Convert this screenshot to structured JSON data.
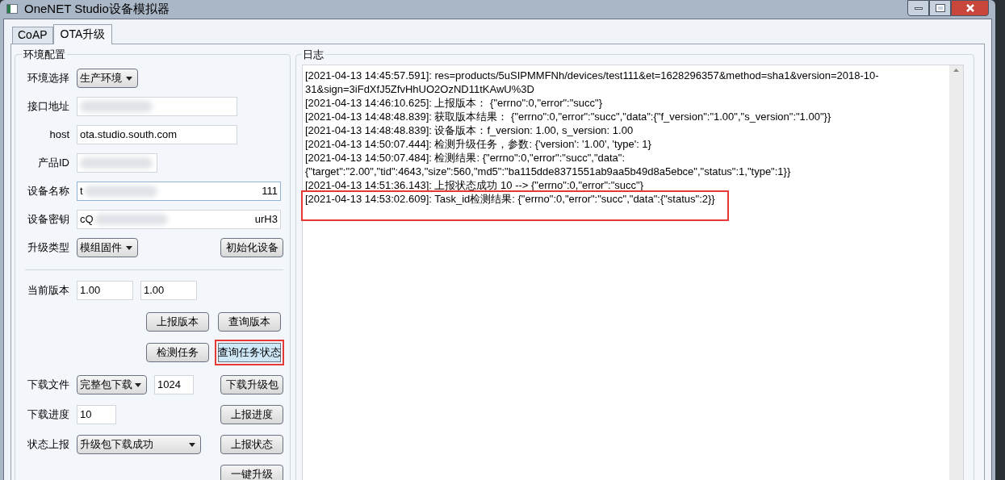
{
  "window": {
    "title": "OneNET Studio设备模拟器"
  },
  "tabs": [
    {
      "label": "CoAP",
      "selected": false
    },
    {
      "label": "OTA升级",
      "selected": true
    }
  ],
  "config": {
    "title": "环境配置",
    "rows": [
      {
        "kind": "select",
        "label": "环境选择",
        "value": "生产环境"
      },
      {
        "kind": "input",
        "label": "接口地址",
        "redacted": true
      },
      {
        "kind": "input",
        "label": "host",
        "value": "ota.studio.south.com"
      },
      {
        "kind": "input",
        "label": "产品ID",
        "redacted": true,
        "short": true
      },
      {
        "kind": "input",
        "label": "设备名称",
        "value_start": "t",
        "value_end": "111",
        "redacted": true,
        "focused": true
      },
      {
        "kind": "input",
        "label": "设备密钥",
        "value_start": "cQ",
        "value_end": "urH3",
        "redacted": true
      },
      {
        "kind": "select",
        "label": "升级类型",
        "value": "模组固件",
        "button": {
          "label": "初始化设备",
          "highlighted": false
        }
      }
    ],
    "version": {
      "label": "当前版本",
      "values": [
        "1.00",
        "1.00"
      ]
    },
    "buttons": [
      {
        "label": "上报版本",
        "highlighted": false
      },
      {
        "label": "查询版本",
        "highlighted": false
      },
      {
        "label": "检测任务",
        "highlighted": false
      },
      {
        "label": "查询任务状态",
        "highlighted": true
      }
    ],
    "rows2": [
      {
        "kind": "select_input",
        "label": "下载文件",
        "value": "完整包下载",
        "extra": "1024",
        "button": {
          "label": "下载升级包",
          "highlighted": false
        }
      },
      {
        "kind": "input",
        "label": "下载进度",
        "value": "10",
        "button": {
          "label": "上报进度",
          "highlighted": false
        }
      },
      {
        "kind": "wide_select",
        "label": "状态上报",
        "value": "升级包下载成功",
        "button": {
          "label": "上报状态",
          "highlighted": false
        }
      },
      {
        "kind": "button_only",
        "button": {
          "label": "一键升级",
          "highlighted": false
        }
      }
    ]
  },
  "log": {
    "title": "日志",
    "lines": [
      {
        "text": "[2021-04-13 14:45:57.591]: res=products/5uSIPMMFNh/devices/test111&et=1628296357&method=sha1&version=2018-10-31&sign=3iFdXfJ5ZfvHhUO2OzND11tKAwU%3D",
        "highlighted": false
      },
      {
        "text": "[2021-04-13 14:46:10.625]: 上报版本： {\"errno\":0,\"error\":\"succ\"}",
        "highlighted": false
      },
      {
        "text": "[2021-04-13 14:48:48.839]: 获取版本结果： {\"errno\":0,\"error\":\"succ\",\"data\":{\"f_version\":\"1.00\",\"s_version\":\"1.00\"}}",
        "highlighted": false
      },
      {
        "text": "[2021-04-13 14:48:48.839]: 设备版本：f_version: 1.00, s_version: 1.00",
        "highlighted": false
      },
      {
        "text": "[2021-04-13 14:50:07.444]: 检测升级任务，参数: {'version': '1.00', 'type': 1}",
        "highlighted": false
      },
      {
        "text": "[2021-04-13 14:50:07.484]: 检测结果: {\"errno\":0,\"error\":\"succ\",\"data\": {\"target\":\"2.00\",\"tid\":4643,\"size\":560,\"md5\":\"ba115dde8371551ab9aa5b49d8a5ebce\",\"status\":1,\"type\":1}}",
        "highlighted": false
      },
      {
        "text": "[2021-04-13 14:51:36.143]: 上报状态成功 10 --> {\"errno\":0,\"error\":\"succ\"}",
        "highlighted": false
      },
      {
        "text": "[2021-04-13 14:53:02.609]: Task_id检测结果:  {\"errno\":0,\"error\":\"succ\",\"data\":{\"status\":2}}",
        "highlighted": true
      }
    ]
  }
}
